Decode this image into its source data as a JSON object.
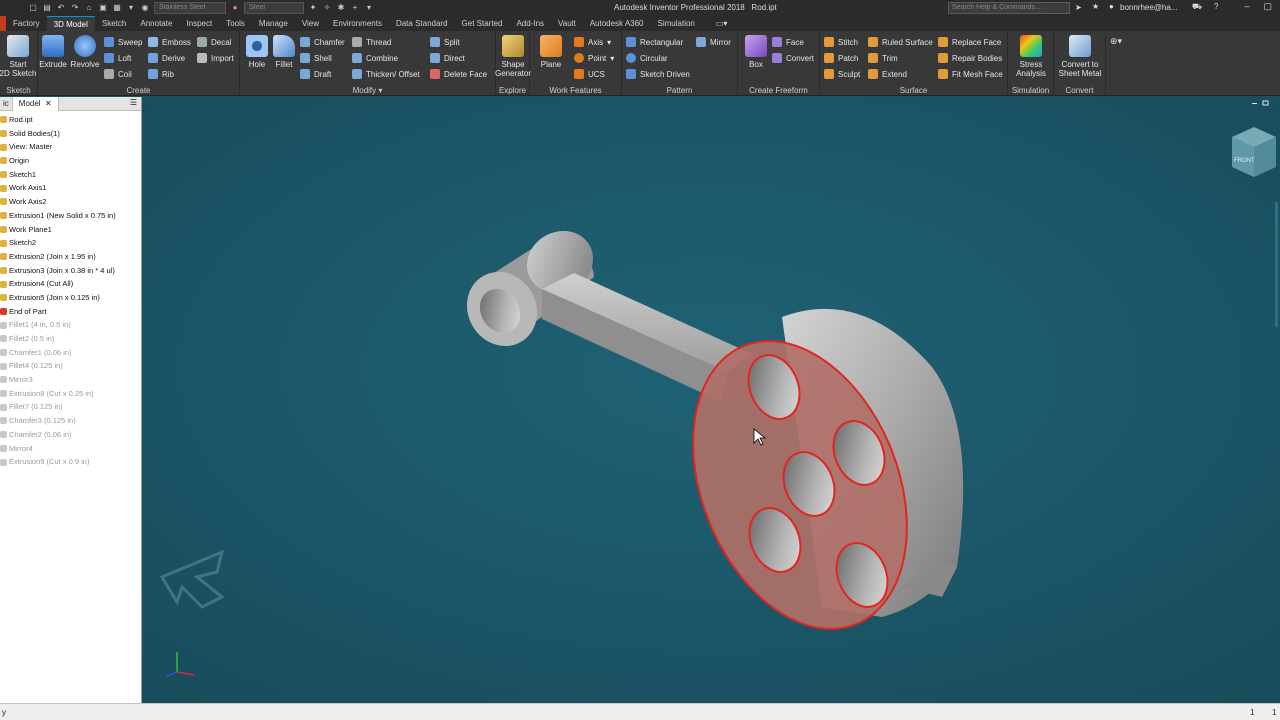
{
  "app_title": "Autodesk Inventor Professional 2018",
  "document_name": "Rod.ipt",
  "quick_access": {
    "material": "Stainless Steel",
    "appearance": "Steel"
  },
  "search": {
    "placeholder": "Search Help & Commands..."
  },
  "user": {
    "name": "bonnrhee@ha..."
  },
  "tabs": [
    {
      "label": ""
    },
    {
      "label": "Factory"
    },
    {
      "label": "3D Model"
    },
    {
      "label": "Sketch"
    },
    {
      "label": "Annotate"
    },
    {
      "label": "Inspect"
    },
    {
      "label": "Tools"
    },
    {
      "label": "Manage"
    },
    {
      "label": "View"
    },
    {
      "label": "Environments"
    },
    {
      "label": "Data Standard"
    },
    {
      "label": "Get Started"
    },
    {
      "label": "Add-Ins"
    },
    {
      "label": "Vault"
    },
    {
      "label": "Autodesk A360"
    },
    {
      "label": "Simulation"
    }
  ],
  "ribbon": {
    "sketch": {
      "title": "Sketch",
      "start_sketch": "Start\n2D Sketch"
    },
    "create": {
      "title": "Create",
      "extrude": "Extrude",
      "revolve": "Revolve",
      "sweep": "Sweep",
      "emboss": "Emboss",
      "decal": "Decal",
      "loft": "Loft",
      "derive": "Derive",
      "import": "Import",
      "coil": "Coil",
      "rib": "Rib"
    },
    "modify": {
      "title": "Modify",
      "hole": "Hole",
      "fillet": "Fillet",
      "chamfer": "Chamfer",
      "thread": "Thread",
      "shell": "Shell",
      "combine": "Combine",
      "draft": "Draft",
      "thicken": "Thicken/ Offset",
      "split": "Split",
      "direct": "Direct",
      "delete_face": "Delete Face"
    },
    "explore": {
      "title": "Explore",
      "shape_generator": "Shape Generator"
    },
    "work_features": {
      "title": "Work Features",
      "plane": "Plane",
      "axis": "Axis",
      "point": "Point",
      "ucs": "UCS"
    },
    "pattern": {
      "title": "Pattern",
      "rectangular": "Rectangular",
      "circular": "Circular",
      "sketch_driven": "Sketch Driven",
      "mirror": "Mirror"
    },
    "freeform": {
      "title": "Create Freeform",
      "box": "Box",
      "face": "Face",
      "convert": "Convert"
    },
    "surface": {
      "title": "Surface",
      "stitch": "Stitch",
      "ruled_surface": "Ruled Surface",
      "replace_face": "Replace Face",
      "patch": "Patch",
      "trim": "Trim",
      "repair_bodies": "Repair Bodies",
      "sculpt": "Sculpt",
      "extend": "Extend",
      "fit_mesh_face": "Fit Mesh Face"
    },
    "simulation": {
      "title": "Simulation",
      "stress_analysis": "Stress Analysis"
    },
    "convert": {
      "title": "Convert",
      "to_sheet_metal": "Convert to Sheet Metal"
    }
  },
  "browser": {
    "tab_left": "ic",
    "tab_model": "Model",
    "tree": [
      {
        "label": "Rod.ipt",
        "gray": false
      },
      {
        "label": "Solid Bodies(1)",
        "gray": false
      },
      {
        "label": "View: Master",
        "gray": false
      },
      {
        "label": "Origin",
        "gray": false
      },
      {
        "label": "Sketch1",
        "gray": false
      },
      {
        "label": "Work Axis1",
        "gray": false
      },
      {
        "label": "Work Axis2",
        "gray": false
      },
      {
        "label": "Extrusion1 (New Solid x 0.75 in)",
        "gray": false
      },
      {
        "label": "Work Plane1",
        "gray": false
      },
      {
        "label": "Sketch2",
        "gray": false
      },
      {
        "label": "Extrusion2 (Join x 1.95 in)",
        "gray": false
      },
      {
        "label": "Extrusion3 (Join x 0.38 in * 4 ul)",
        "gray": false
      },
      {
        "label": "Extrusion4 (Cut All)",
        "gray": false
      },
      {
        "label": "Extrusion5 (Join x 0.125 in)",
        "gray": false
      },
      {
        "label": "End of Part",
        "gray": false
      },
      {
        "label": "Fillet1 (4 in, 0.5 in)",
        "gray": true
      },
      {
        "label": "Fillet2 (0.5 in)",
        "gray": true
      },
      {
        "label": "Chamfer1 (0.06 in)",
        "gray": true
      },
      {
        "label": "Fillet4 (0.125 in)",
        "gray": true
      },
      {
        "label": "Mirror3",
        "gray": true
      },
      {
        "label": "Extrusion8 (Cut x 0.25 in)",
        "gray": true
      },
      {
        "label": "Fillet7 (0.125 in)",
        "gray": true
      },
      {
        "label": "Chamfer3 (0.125 in)",
        "gray": true
      },
      {
        "label": "Chamfer2 (0.06 in)",
        "gray": true
      },
      {
        "label": "Mirror4",
        "gray": true
      },
      {
        "label": "Extrusion9 (Cut x 0.9 in)",
        "gray": true
      }
    ]
  },
  "viewcube": {
    "label": "FRONT"
  },
  "status": {
    "left": "y",
    "right": "1",
    "right2": "1"
  },
  "colors": {
    "viewport_bg": "#1d5566",
    "highlight": "#e0261e",
    "part": "#a9a9a9"
  }
}
